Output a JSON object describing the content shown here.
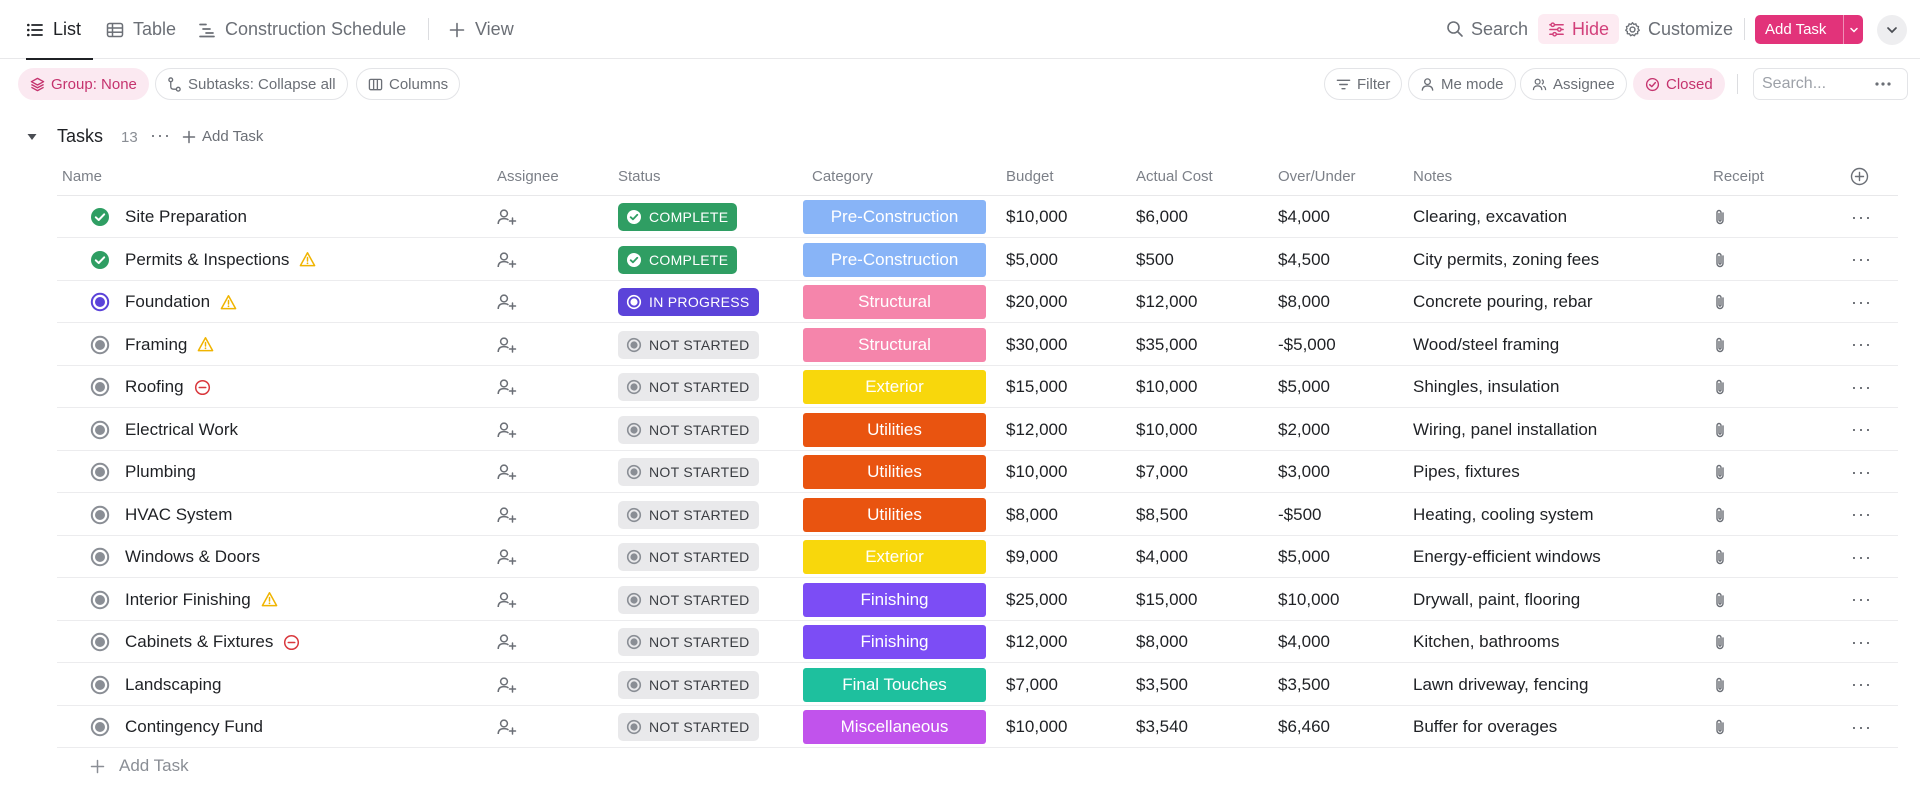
{
  "viewbar": {
    "tabs": [
      {
        "label": "List"
      },
      {
        "label": "Table"
      },
      {
        "label": "Construction Schedule"
      },
      {
        "label": "View"
      }
    ],
    "search_label": "Search",
    "hide_label": "Hide",
    "customize_label": "Customize",
    "add_task_label": "Add Task"
  },
  "filterbar": {
    "group_label": "Group: None",
    "subtasks_label": "Subtasks: Collapse all",
    "columns_label": "Columns",
    "filter_label": "Filter",
    "me_mode_label": "Me mode",
    "assignee_label": "Assignee",
    "closed_label": "Closed",
    "search_placeholder": "Search..."
  },
  "group": {
    "title": "Tasks",
    "count": "13",
    "add_label": "Add Task"
  },
  "columns": {
    "name": "Name",
    "assignee": "Assignee",
    "status": "Status",
    "category": "Category",
    "budget": "Budget",
    "actual": "Actual Cost",
    "over": "Over/Under",
    "notes": "Notes",
    "receipt": "Receipt"
  },
  "colors": {
    "accent": "#e2337a",
    "complete": "#2f9e63",
    "in_progress": "#5b43d9",
    "not_started": "#e9e9eb",
    "Pre-Construction": "#88b4f7",
    "Structural": "#f585ab",
    "Exterior": "#f8d70c",
    "Utilities": "#e95410",
    "Finishing": "#7c4df5",
    "Final Touches": "#1ec09e",
    "Miscellaneous": "#c153ec"
  },
  "tasks": [
    {
      "name": "Site Preparation",
      "flag": "",
      "status": "COMPLETE",
      "category": "Pre-Construction",
      "budget": "$10,000",
      "actual": "$6,000",
      "over": "$4,000",
      "notes": "Clearing, excavation"
    },
    {
      "name": "Permits & Inspections",
      "flag": "warning",
      "status": "COMPLETE",
      "category": "Pre-Construction",
      "budget": "$5,000",
      "actual": "$500",
      "over": "$4,500",
      "notes": "City permits, zoning fees"
    },
    {
      "name": "Foundation",
      "flag": "warning",
      "status": "IN PROGRESS",
      "category": "Structural",
      "budget": "$20,000",
      "actual": "$12,000",
      "over": "$8,000",
      "notes": "Concrete pouring, rebar"
    },
    {
      "name": "Framing",
      "flag": "warning",
      "status": "NOT STARTED",
      "category": "Structural",
      "budget": "$30,000",
      "actual": "$35,000",
      "over": "-$5,000",
      "notes": "Wood/steel framing"
    },
    {
      "name": "Roofing",
      "flag": "blocked",
      "status": "NOT STARTED",
      "category": "Exterior",
      "budget": "$15,000",
      "actual": "$10,000",
      "over": "$5,000",
      "notes": "Shingles, insulation"
    },
    {
      "name": "Electrical Work",
      "flag": "",
      "status": "NOT STARTED",
      "category": "Utilities",
      "budget": "$12,000",
      "actual": "$10,000",
      "over": "$2,000",
      "notes": "Wiring, panel installation"
    },
    {
      "name": "Plumbing",
      "flag": "",
      "status": "NOT STARTED",
      "category": "Utilities",
      "budget": "$10,000",
      "actual": "$7,000",
      "over": "$3,000",
      "notes": "Pipes, fixtures"
    },
    {
      "name": "HVAC System",
      "flag": "",
      "status": "NOT STARTED",
      "category": "Utilities",
      "budget": "$8,000",
      "actual": "$8,500",
      "over": "-$500",
      "notes": "Heating, cooling system"
    },
    {
      "name": "Windows & Doors",
      "flag": "",
      "status": "NOT STARTED",
      "category": "Exterior",
      "budget": "$9,000",
      "actual": "$4,000",
      "over": "$5,000",
      "notes": "Energy-efficient windows"
    },
    {
      "name": "Interior Finishing",
      "flag": "warning",
      "status": "NOT STARTED",
      "category": "Finishing",
      "budget": "$25,000",
      "actual": "$15,000",
      "over": "$10,000",
      "notes": "Drywall, paint, flooring"
    },
    {
      "name": "Cabinets & Fixtures",
      "flag": "blocked",
      "status": "NOT STARTED",
      "category": "Finishing",
      "budget": "$12,000",
      "actual": "$8,000",
      "over": "$4,000",
      "notes": "Kitchen, bathrooms"
    },
    {
      "name": "Landscaping",
      "flag": "",
      "status": "NOT STARTED",
      "category": "Final Touches",
      "budget": "$7,000",
      "actual": "$3,500",
      "over": "$3,500",
      "notes": "Lawn driveway, fencing"
    },
    {
      "name": "Contingency Fund",
      "flag": "",
      "status": "NOT STARTED",
      "category": "Miscellaneous",
      "budget": "$10,000",
      "actual": "$3,540",
      "over": "$6,460",
      "notes": "Buffer for overages"
    }
  ],
  "footer": {
    "add_task_label": "Add Task"
  }
}
